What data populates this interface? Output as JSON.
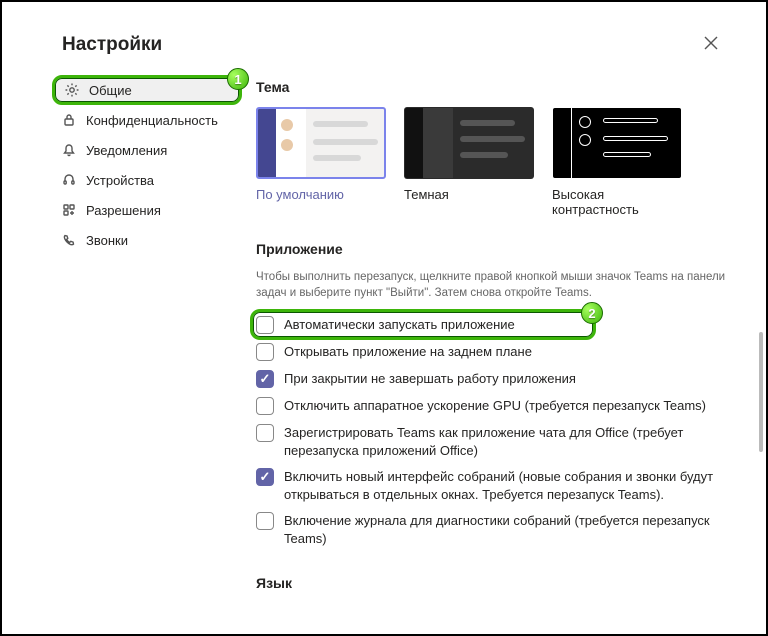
{
  "header": {
    "title": "Настройки"
  },
  "sidebar": {
    "items": [
      {
        "label": "Общие"
      },
      {
        "label": "Конфиденциальность"
      },
      {
        "label": "Уведомления"
      },
      {
        "label": "Устройства"
      },
      {
        "label": "Разрешения"
      },
      {
        "label": "Звонки"
      }
    ]
  },
  "badges": {
    "one": "1",
    "two": "2"
  },
  "theme": {
    "heading": "Тема",
    "options": [
      {
        "label": "По умолчанию"
      },
      {
        "label": "Темная"
      },
      {
        "label": "Высокая контрастность"
      }
    ]
  },
  "app": {
    "heading": "Приложение",
    "description": "Чтобы выполнить перезапуск, щелкните правой кнопкой мыши значок Teams на панели задач и выберите пункт \"Выйти\". Затем снова откройте Teams.",
    "options": [
      {
        "label": "Автоматически запускать приложение",
        "checked": false
      },
      {
        "label": "Открывать приложение на заднем плане",
        "checked": false
      },
      {
        "label": "При закрытии не завершать работу приложения",
        "checked": true
      },
      {
        "label": "Отключить аппаратное ускорение GPU (требуется перезапуск Teams)",
        "checked": false
      },
      {
        "label": "Зарегистрировать Teams как приложение чата для Office (требует перезапуска приложений Office)",
        "checked": false
      },
      {
        "label": "Включить новый интерфейс собраний (новые собрания и звонки будут открываться в отдельных окнах. Требуется перезапуск Teams).",
        "checked": true
      },
      {
        "label": "Включение журнала для диагностики собраний (требуется перезапуск Teams)",
        "checked": false
      }
    ]
  },
  "lang": {
    "heading": "Язык"
  }
}
